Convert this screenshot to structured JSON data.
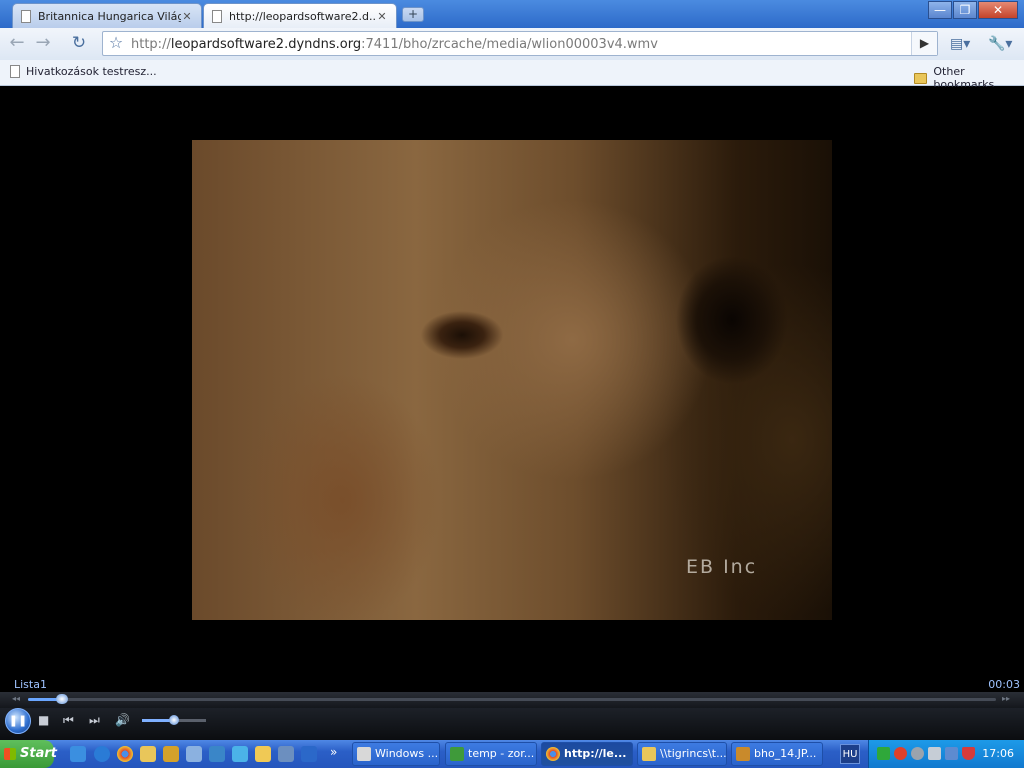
{
  "browser": {
    "tabs": [
      {
        "title": "Britannica Hungarica Világe...",
        "active": false
      },
      {
        "title": "http://leopardsoftware2.d...",
        "active": true
      }
    ],
    "new_tab_label": "+",
    "window_buttons": {
      "minimize": "—",
      "restore": "❐",
      "close": "✕"
    },
    "nav": {
      "back": "←",
      "forward": "→",
      "reload": "↻",
      "star": "☆"
    },
    "url": {
      "scheme": "http://",
      "host": "leopardsoftware2.dyndns.org",
      "rest": ":7411/bho/zrcache/media/wlion00003v4.wmv"
    },
    "go_label": "▶",
    "page_menu": "▤▾",
    "tools_menu": "🔧▾",
    "bookmarks_bar": {
      "item": "Hivatkozások testresz...",
      "other": "Other bookmarks"
    }
  },
  "video": {
    "watermark": "EB Inc"
  },
  "player": {
    "playlist": "Lista1",
    "time": "00:03",
    "seek_progress": 0.035,
    "volume_level": 0.5,
    "play_pause": "❚❚",
    "stop": "■",
    "prev": "⏮",
    "next": "⏭",
    "mute": "🔊",
    "seek_left": "◂◂",
    "seek_right": "▸▸"
  },
  "taskbar": {
    "start_label": "Start",
    "ql_more": "»",
    "tasks": [
      {
        "label": "Windows ...",
        "active": false,
        "icon_color": "#d8d8d8"
      },
      {
        "label": "temp - zor...",
        "active": false,
        "icon_color": "#3f9a3a"
      },
      {
        "label": "http://le...",
        "active": true,
        "icon_color": "#e04b2a"
      },
      {
        "label": "\\\\tigrincs\\t...",
        "active": false,
        "icon_color": "#e9c65a"
      },
      {
        "label": "bho_14.JP...",
        "active": false,
        "icon_color": "#c98a2b"
      }
    ],
    "language": "HU",
    "clock": "17:06"
  },
  "colors": {
    "accent": "#6aa6ff",
    "taskbar_blue": "#2b5fc7",
    "start_green": "#3a9a37"
  }
}
